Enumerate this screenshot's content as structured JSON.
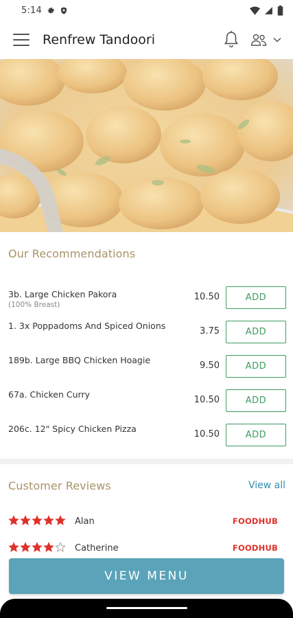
{
  "status_bar": {
    "time": "5:14",
    "icons": [
      "gear-icon",
      "shield-icon",
      "wifi-icon",
      "signal-icon",
      "battery-icon"
    ]
  },
  "app_bar": {
    "title": "Renfrew Tandoori",
    "icons": [
      "hamburger-menu-icon",
      "bell-icon",
      "profile-icon",
      "chevron-down-icon"
    ]
  },
  "hero": {
    "image": "chicken-curry-photo"
  },
  "recommendations": {
    "title": "Our Recommendations",
    "items": [
      {
        "name": "3b. Large Chicken Pakora",
        "sub": "(100% Breast)",
        "price": "10.50",
        "add_label": "ADD"
      },
      {
        "name": "1. 3x Poppadoms And Spiced Onions",
        "sub": "",
        "price": "3.75",
        "add_label": "ADD"
      },
      {
        "name": "189b. Large BBQ Chicken Hoagie",
        "sub": "",
        "price": "9.50",
        "add_label": "ADD"
      },
      {
        "name": "67a. Chicken Curry",
        "sub": "",
        "price": "10.50",
        "add_label": "ADD"
      },
      {
        "name": "206c. 12\" Spicy Chicken Pizza",
        "sub": "",
        "price": "10.50",
        "add_label": "ADD"
      }
    ]
  },
  "reviews": {
    "title": "Customer Reviews",
    "view_all": "View all",
    "items": [
      {
        "name": "Alan",
        "rating": 5,
        "source": "FOODHUB"
      },
      {
        "name": "Catherine",
        "rating": 4,
        "source": "FOODHUB"
      }
    ]
  },
  "view_menu_label": "VIEW MENU",
  "colors": {
    "accent_gold": "#a89368",
    "add_green": "#3e9a5f",
    "link_blue": "#2e8fb0",
    "button_teal": "#5aa3b8",
    "star_red": "#e0302a"
  }
}
